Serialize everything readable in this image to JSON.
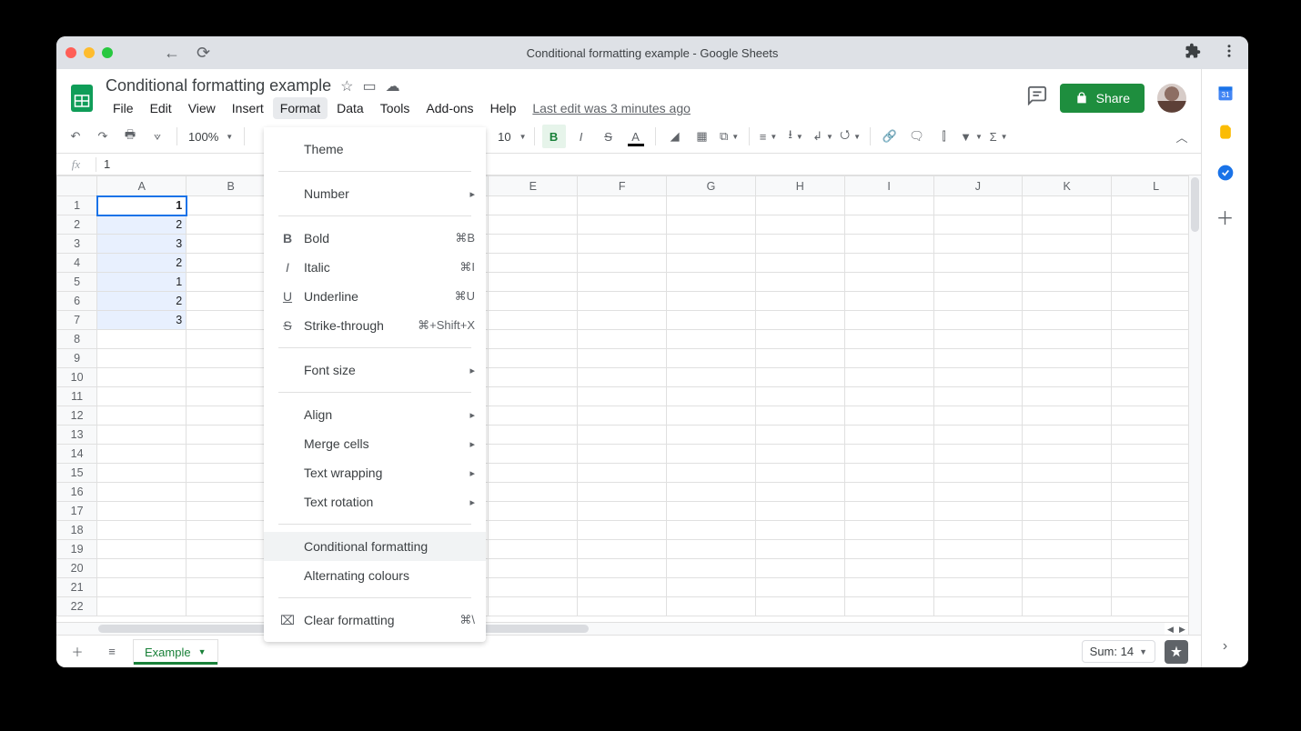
{
  "browser": {
    "tab_title": "Conditional formatting example - Google Sheets"
  },
  "doc": {
    "title": "Conditional formatting example",
    "last_edit": "Last edit was 3 minutes ago",
    "share_label": "Share"
  },
  "menubar": {
    "file": "File",
    "edit": "Edit",
    "view": "View",
    "insert": "Insert",
    "format": "Format",
    "data": "Data",
    "tools": "Tools",
    "addons": "Add-ons",
    "help": "Help"
  },
  "toolbar": {
    "zoom": "100%",
    "font_size": "10"
  },
  "formula_bar": {
    "value": "1"
  },
  "columns": [
    "A",
    "B",
    "E",
    "F",
    "G",
    "H",
    "I",
    "J",
    "K",
    "L"
  ],
  "rows": [
    "1",
    "2",
    "3",
    "4",
    "5",
    "6",
    "7",
    "8",
    "9",
    "10",
    "11",
    "12",
    "13",
    "14",
    "15",
    "16",
    "17",
    "18",
    "19",
    "20",
    "21",
    "22"
  ],
  "cells_A": [
    "1",
    "2",
    "3",
    "2",
    "1",
    "2",
    "3"
  ],
  "menu": {
    "theme": "Theme",
    "number": "Number",
    "bold": "Bold",
    "bold_sc": "⌘B",
    "italic": "Italic",
    "italic_sc": "⌘I",
    "underline": "Underline",
    "underline_sc": "⌘U",
    "strike": "Strike-through",
    "strike_sc": "⌘+Shift+X",
    "fontsize": "Font size",
    "align": "Align",
    "merge": "Merge cells",
    "wrap": "Text wrapping",
    "rotation": "Text rotation",
    "condfmt": "Conditional formatting",
    "altcolors": "Alternating colours",
    "clear": "Clear formatting",
    "clear_sc": "⌘\\"
  },
  "footer": {
    "sheet_name": "Example",
    "sum": "Sum: 14"
  }
}
